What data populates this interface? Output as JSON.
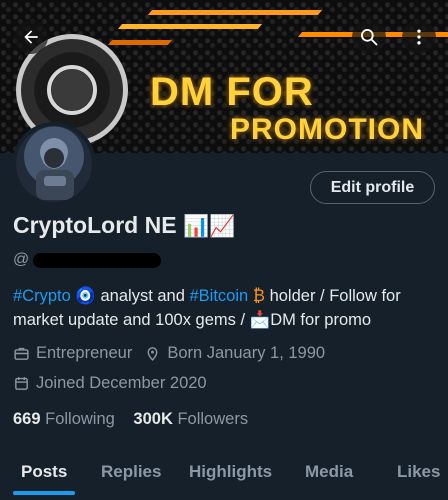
{
  "banner": {
    "promo_line1": "DM FOR",
    "promo_line2": "PROMOTION",
    "accent": "#ffd23c"
  },
  "topbar": {
    "back_icon": "arrow-left-icon",
    "search_icon": "search-icon",
    "more_icon": "more-vertical-icon"
  },
  "profile": {
    "edit_label": "Edit profile",
    "name": "CryptoLord NE",
    "name_emojis": "📊📈",
    "handle_prefix": "@",
    "bio": {
      "tag1": "#Crypto",
      "sym1": "🧿",
      "text1": " analyst and ",
      "tag2": "#Bitcoin",
      "sym2": "₿",
      "text2": " holder / Follow for market update and 100x gems / ",
      "sym3": "📩",
      "text3": "DM for promo"
    },
    "occupation": "Entrepreneur",
    "born": "Born January 1, 1990",
    "joined": "Joined December 2020",
    "following_count": "669",
    "following_label": "Following",
    "followers_count": "300K",
    "followers_label": "Followers"
  },
  "tabs": [
    "Posts",
    "Replies",
    "Highlights",
    "Media",
    "Likes"
  ],
  "colors": {
    "background": "#15202b",
    "link": "#1d9bf0",
    "muted": "#8b98a5",
    "text": "#e7e9ea"
  }
}
